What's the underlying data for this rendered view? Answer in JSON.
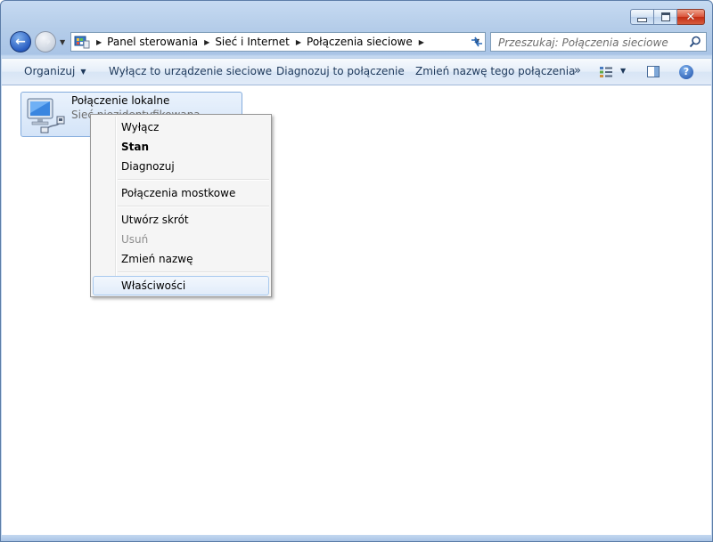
{
  "window": {
    "caption": {
      "minimize": "minimize-icon",
      "maximize": "maximize-icon",
      "close": "close-icon"
    }
  },
  "navigation": {
    "breadcrumbs": [
      "Panel sterowania",
      "Sieć i Internet",
      "Połączenia sieciowe"
    ],
    "search_placeholder": "Przeszukaj: Połączenia sieciowe"
  },
  "commandbar": {
    "organize": "Organizuj",
    "disable_device": "Wyłącz to urządzenie sieciowe",
    "diagnose": "Diagnozuj to połączenie",
    "rename": "Zmień nazwę tego połączenia",
    "more": "»"
  },
  "connection": {
    "name": "Połączenie lokalne",
    "status": "Sieć niezidentyfikowana"
  },
  "context_menu": {
    "items": [
      {
        "label": "Wyłącz",
        "style": "normal"
      },
      {
        "label": "Stan",
        "style": "bold"
      },
      {
        "label": "Diagnozuj",
        "style": "normal"
      },
      {
        "label": "Połączenia mostkowe",
        "style": "normal"
      },
      {
        "label": "Utwórz skrót",
        "style": "normal"
      },
      {
        "label": "Usuń",
        "style": "disabled"
      },
      {
        "label": "Zmień nazwę",
        "style": "normal"
      },
      {
        "label": "Właściwości",
        "style": "hover"
      }
    ]
  },
  "colors": {
    "frame": "#b5cde9",
    "accent_text": "#1e395b",
    "selection": "#d4e4f8",
    "close_button": "#c32e14"
  }
}
